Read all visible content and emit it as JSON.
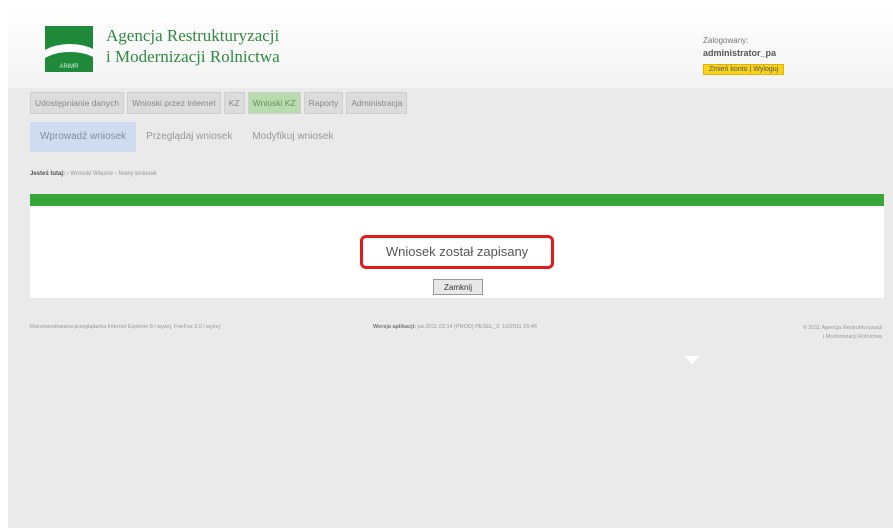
{
  "header": {
    "org_name_line1": "Agencja Restrukturyzacji",
    "org_name_line2": "i Modernizacji Rolnictwa",
    "logo_text": "ARiMR",
    "user_caption": "Zalogowany:",
    "user_name": "administrator_pa",
    "edit_account": "Zmień konto",
    "logout": "Wyloguj"
  },
  "nav": {
    "items": [
      {
        "label": "Udostępnianie danych"
      },
      {
        "label": "Wnioski przez internet"
      },
      {
        "label": "KZ"
      },
      {
        "label": "Wnioski KZ"
      },
      {
        "label": "Raporty"
      },
      {
        "label": "Administracja"
      }
    ]
  },
  "subnav": {
    "items": [
      {
        "label": "Wprowadź wniosek"
      },
      {
        "label": "Przeglądaj wniosek"
      },
      {
        "label": "Modyfikuj wniosek"
      }
    ]
  },
  "breadcrumb": {
    "root": "Jesteś tutaj:",
    "path": "› Wnioski Własne › Nowy wniosek"
  },
  "content": {
    "message": "Wniosek został zapisany",
    "close_label": "Zamknij"
  },
  "footer": {
    "left": "Rekomendowana przeglądarka Internet Explorer 8 i wyżej, FireFox 3.0 i wyżej",
    "mid_label": "Wersja aplikacji:",
    "mid_value": "pa-2011.03.14 (PROD) PESEL_3. 10/2011 16:46",
    "right_line1": "© 2011 Agencja Restrukturyzacji",
    "right_line2": "i Modernizacji Rolnictwa"
  },
  "colors": {
    "brand_green": "#2f8a3f",
    "bar_green": "#3aa63a",
    "highlight_red": "#e11b1b",
    "user_buttons_yellow": "#f6d21a"
  },
  "icons": {
    "logo": "arimr-logo-icon"
  }
}
